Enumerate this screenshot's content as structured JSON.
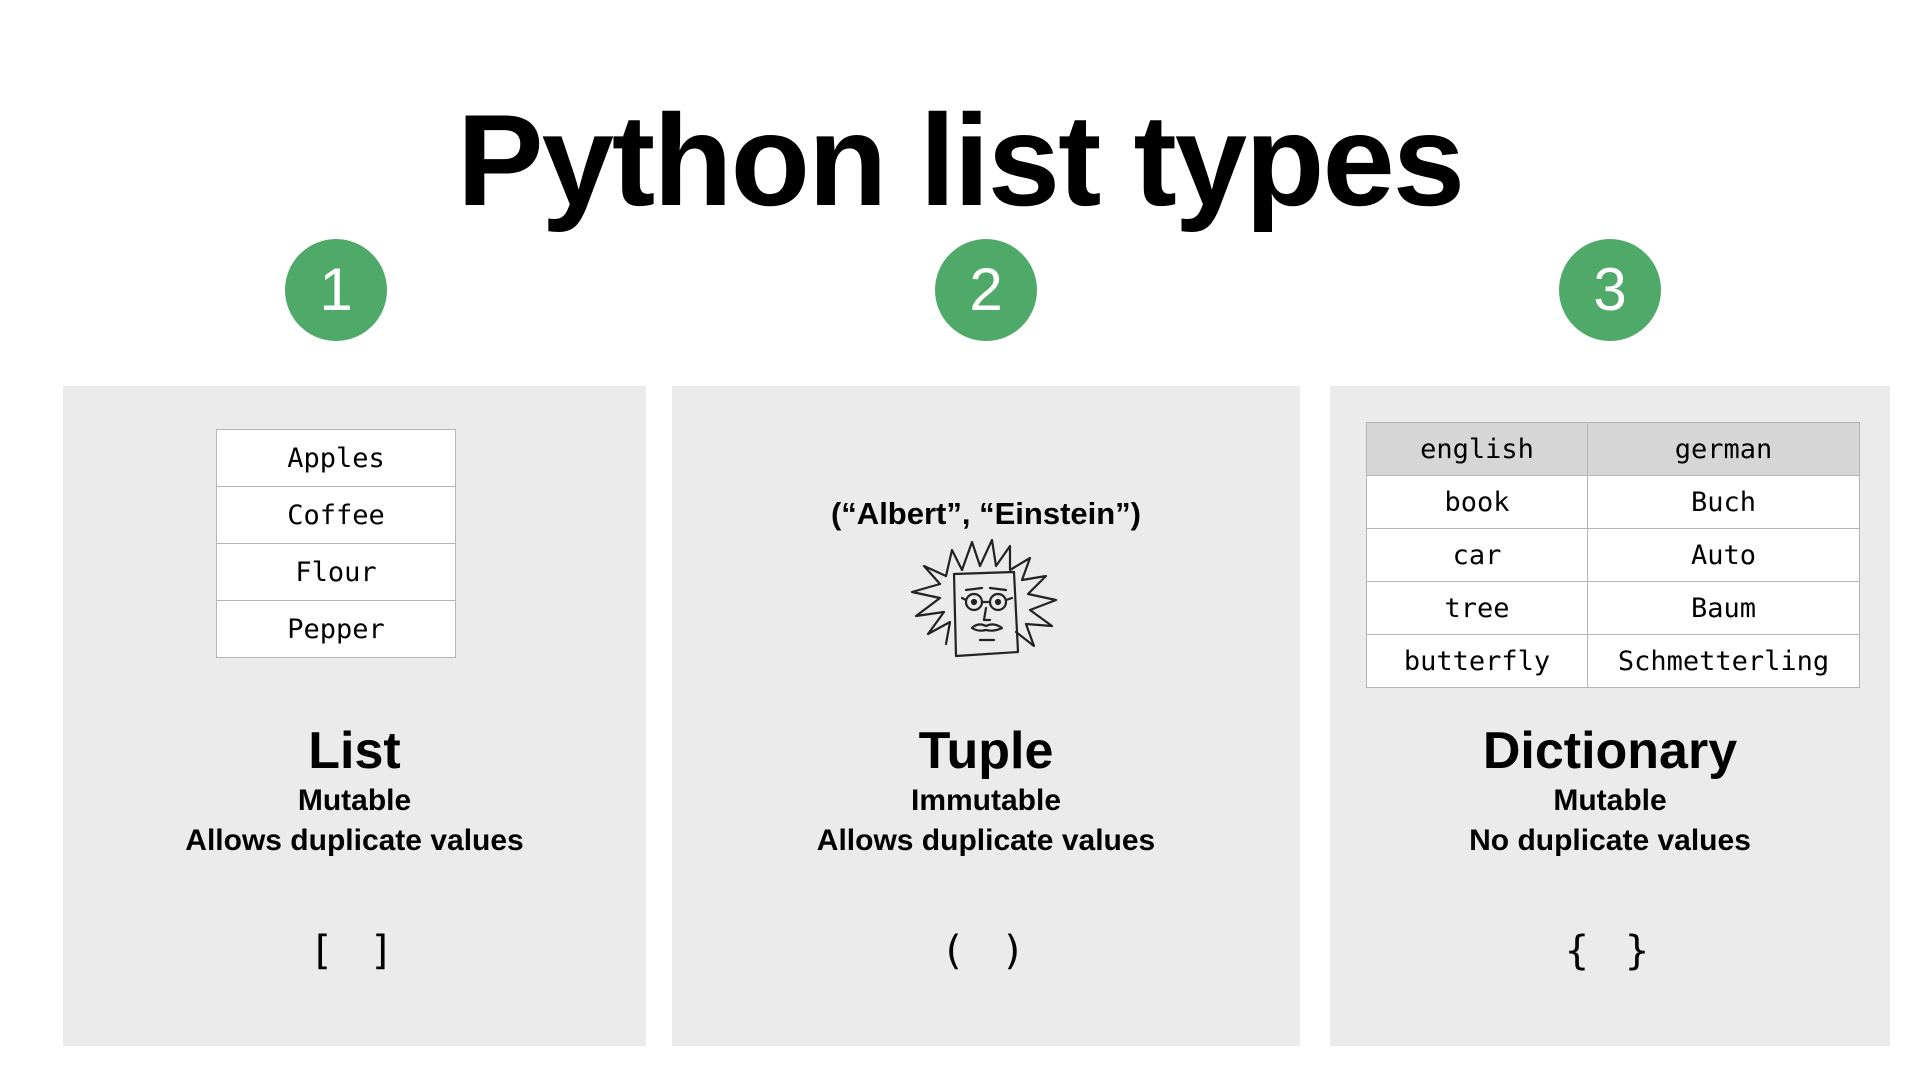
{
  "title": "Python list types",
  "badges": [
    "1",
    "2",
    "3"
  ],
  "colors": {
    "badge": "#4faa6a",
    "panel": "#ebebeb",
    "table_header": "#d6d6d6"
  },
  "list": {
    "items": [
      "Apples",
      "Coffee",
      "Flour",
      "Pepper"
    ],
    "name": "List",
    "mutability": "Mutable",
    "duplicates": "Allows duplicate values",
    "brackets": "[ ]"
  },
  "tuple": {
    "example": "(“Albert”, “Einstein”)",
    "illustration": "einstein-sketch",
    "name": "Tuple",
    "mutability": "Immutable",
    "duplicates": "Allows duplicate values",
    "brackets": "( )"
  },
  "dictionary": {
    "headers": [
      "english",
      "german"
    ],
    "rows": [
      [
        "book",
        "Buch"
      ],
      [
        "car",
        "Auto"
      ],
      [
        "tree",
        "Baum"
      ],
      [
        "butterfly",
        "Schmetterling"
      ]
    ],
    "name": "Dictionary",
    "mutability": "Mutable",
    "duplicates": "No duplicate values",
    "brackets": "{ }"
  }
}
